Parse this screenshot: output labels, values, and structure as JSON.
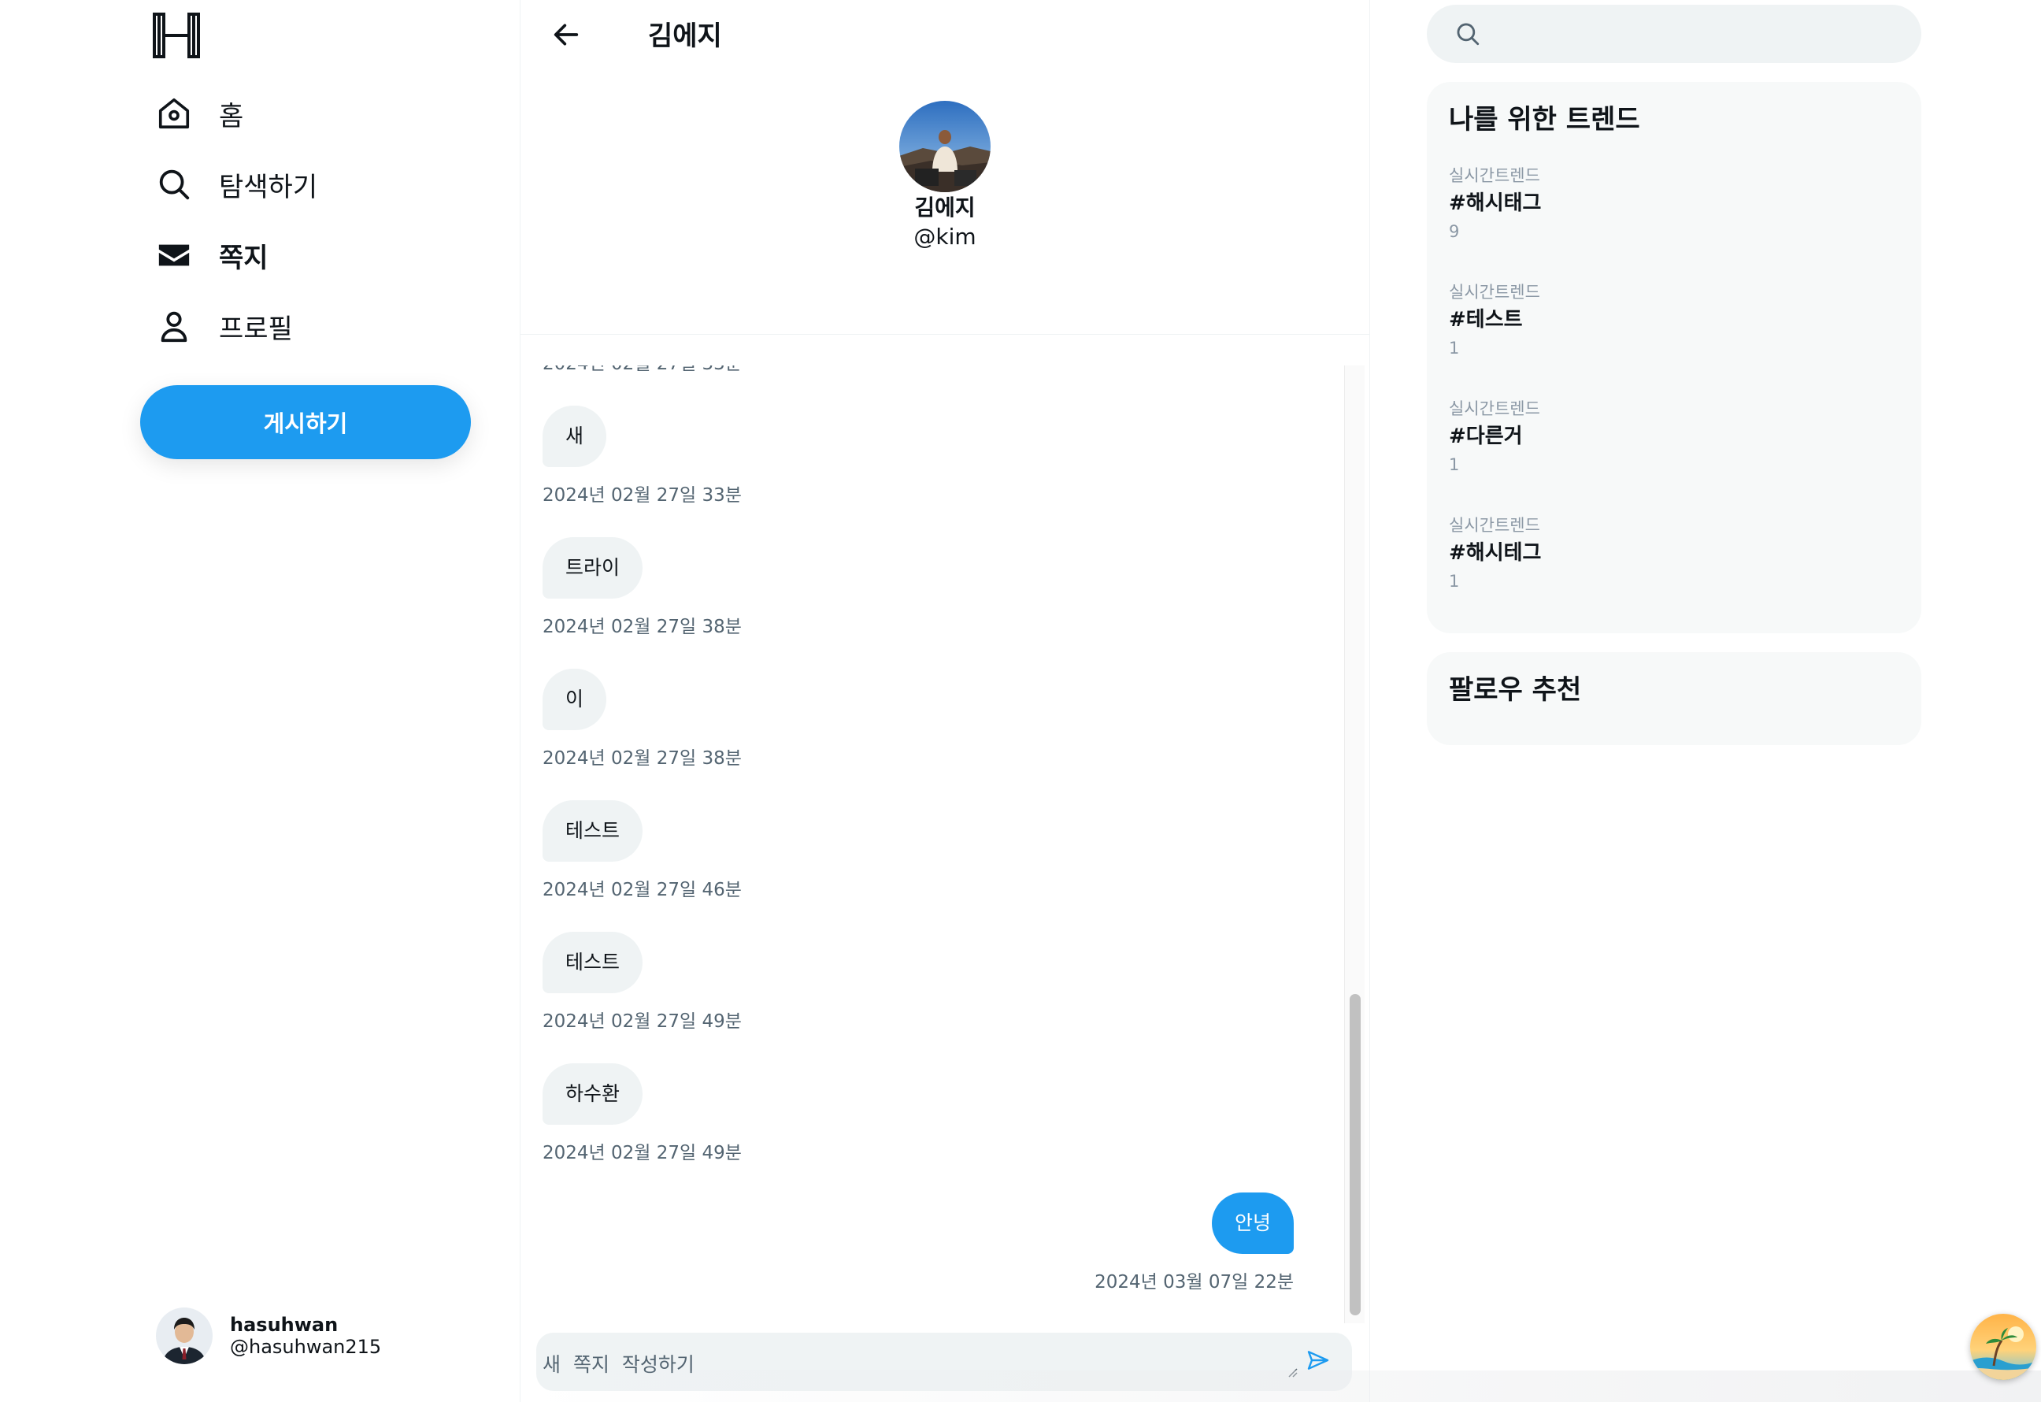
{
  "nav": {
    "items": [
      {
        "key": "home",
        "label": "홈",
        "icon": "home-icon"
      },
      {
        "key": "explore",
        "label": "탐색하기",
        "icon": "search-icon"
      },
      {
        "key": "messages",
        "label": "쪽지",
        "icon": "mail-icon",
        "active": true
      },
      {
        "key": "profile",
        "label": "프로필",
        "icon": "person-icon"
      }
    ],
    "post_label": "게시하기"
  },
  "account": {
    "name": "hasuhwan",
    "handle": "@hasuhwan215"
  },
  "conversation": {
    "title": "김에지",
    "profile_name": "김에지",
    "profile_handle": "@kim",
    "messages": [
      {
        "text": "새",
        "time": "2024년 02월 27일 33분",
        "mine": false
      },
      {
        "text": "트라이",
        "time": "2024년 02월 27일 38분",
        "mine": false
      },
      {
        "text": "이",
        "time": "2024년 02월 27일 38분",
        "mine": false
      },
      {
        "text": "테스트",
        "time": "2024년 02월 27일 46분",
        "mine": false
      },
      {
        "text": "테스트",
        "time": "2024년 02월 27일 49분",
        "mine": false
      },
      {
        "text": "하수환",
        "time": "2024년 02월 27일 49분",
        "mine": false
      },
      {
        "text": "안녕",
        "time": "2024년 03월 07일 22분",
        "mine": true
      }
    ],
    "composer_placeholder": "새 쪽지 작성하기"
  },
  "trends": {
    "title": "나를 위한 트렌드",
    "items": [
      {
        "kicker": "실시간트렌드",
        "tag": "#해시태그",
        "count": "9"
      },
      {
        "kicker": "실시간트렌드",
        "tag": "#테스트",
        "count": "1"
      },
      {
        "kicker": "실시간트렌드",
        "tag": "#다른거",
        "count": "1"
      },
      {
        "kicker": "실시간트렌드",
        "tag": "#해시테그",
        "count": "1"
      }
    ]
  },
  "follow": {
    "title": "팔로우 추천"
  },
  "colors": {
    "accent": "#1d9bf0",
    "bubble_other": "#eff3f4",
    "muted_text": "#536471"
  }
}
